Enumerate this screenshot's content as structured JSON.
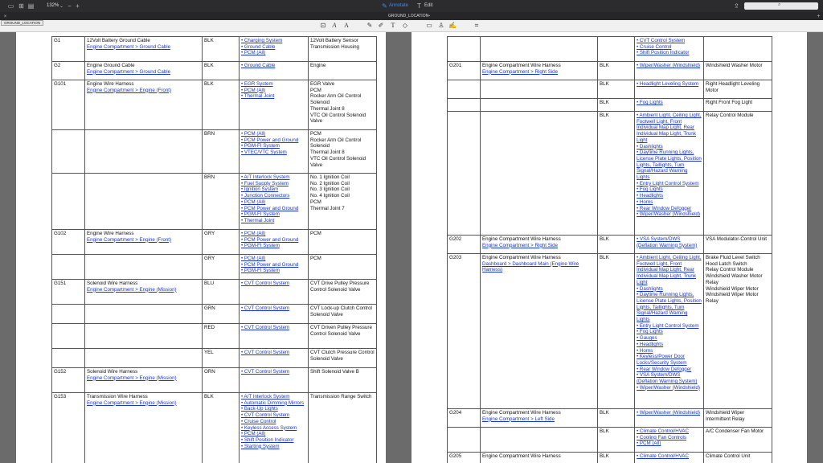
{
  "toolbar": {
    "zoom": "132%"
  },
  "mode_tabs": {
    "annotate": "Annotate",
    "edit": "Edit"
  },
  "document": {
    "title": "GROUND_LOCATION",
    "tab_label": "GROUND_LOCATION"
  },
  "left_rows": [
    {
      "g": "G1",
      "t": "12Volt Battery Ground Cable",
      "p": "Engine Compartment > Ground Cable",
      "c": "BLK",
      "s": [
        "• Charging System",
        "• Ground Cable",
        "• PCM (All)"
      ],
      "x": [
        "12Volt Battery Sensor",
        "Transmission Housing"
      ],
      "h": 31
    },
    {
      "g": "G2",
      "t": "Engine Ground Cable",
      "p": "Engine Compartment > Ground Cable",
      "c": "BLK",
      "s": [
        "• Ground Cable"
      ],
      "x": [
        "Engine"
      ],
      "h": 23
    },
    {
      "g": "G101",
      "t": "Engine Wire Harness",
      "p": "Engine Compartment > Engine (Front)",
      "c": "BLK",
      "s": [
        "• EGR System",
        "• PCM (All)",
        "• Thermal Joint"
      ],
      "x": [
        "EGR Valve",
        "PCM",
        "Rocker Arm Oil Control Solenoid",
        "Thermal Joint 8",
        "VTC Oil Control Solenoid Valve"
      ],
      "h": 62
    },
    {
      "g": "",
      "t": "",
      "p": "",
      "c": "BRN",
      "s": [
        "• PCM (All)",
        "• PCM Power and Ground",
        "• PGM-FI System",
        "• VTEC/VTC System"
      ],
      "x": [
        "PCM",
        "Rocker Arm Oil Control Solenoid",
        "Thermal Joint 8",
        "VTC Oil Control Solenoid Valve"
      ],
      "h": 54
    },
    {
      "g": "",
      "t": "",
      "p": "",
      "c": "BRN",
      "s": [
        "• A/T Interlock System",
        "• Fuel Supply System",
        "• Ignition System",
        "• Junction Connectors",
        "• PCM (All)",
        "• PCM Power and Ground",
        "• PGM-FI System",
        "• Thermal Joint"
      ],
      "x": [
        "No. 1 Ignition Coil",
        "No. 2 Ignition Coil",
        "No. 3 Ignition Coil",
        "No. 4 Ignition Coil",
        "PCM",
        "Thermal Joint 7"
      ],
      "h": 70
    },
    {
      "g": "G102",
      "t": "Engine Wire Harness",
      "p": "Engine Compartment > Engine (Front)",
      "c": "GRY",
      "s": [
        "• PCM (All)",
        "• PCM Power and Ground",
        "• PGM-FI System"
      ],
      "x": [
        "PCM"
      ],
      "h": 31
    },
    {
      "g": "",
      "t": "",
      "p": "",
      "c": "GRY",
      "s": [
        "• PCM (All)",
        "• PCM Power and Ground",
        "• PGM-FI System"
      ],
      "x": [
        "PCM"
      ],
      "h": 31
    },
    {
      "g": "G151",
      "t": "Solenoid Wire Harness",
      "p": "Engine Compartment > Engine (Mission)",
      "c": "BLU",
      "s": [
        "• CVT Control System"
      ],
      "x": [
        "CVT Drive Pulley Pressure Control Solenoid Valve"
      ],
      "h": 31
    },
    {
      "g": "",
      "t": "",
      "p": "",
      "c": "GRN",
      "s": [
        "• CVT Control System"
      ],
      "x": [
        "CVT Lock-up Clutch Control Solenoid Valve"
      ],
      "h": 24
    },
    {
      "g": "",
      "t": "",
      "p": "",
      "c": "RED",
      "s": [
        "• CVT Control System"
      ],
      "x": [
        "CVT Driven Pulley Pressure Control Solenoid Valve"
      ],
      "h": 31
    },
    {
      "g": "",
      "t": "",
      "p": "",
      "c": "YEL",
      "s": [
        "• CVT Control System"
      ],
      "x": [
        "CVT Clutch Pressure Control Solenoid Valve"
      ],
      "h": 24
    },
    {
      "g": "G152",
      "t": "Solenoid Wire Harness",
      "p": "Engine Compartment > Engine (Mission)",
      "c": "ORN",
      "s": [
        "• CVT Control System"
      ],
      "x": [
        "Shift Solenoid Valve B"
      ],
      "h": 31
    },
    {
      "g": "G153",
      "t": "Transmission Wire Harness",
      "p": "Engine Compartment > Engine (Mission)",
      "c": "BLK",
      "s": [
        "• A/T Interlock System",
        "• Automatic Dimming Mirrors",
        "• Back-Up Lights",
        "• CVT Control System",
        "• Cruise Control",
        "• Keyless Access System",
        "• PCM (All)",
        "• Shift Position Indicator",
        "• Starting System"
      ],
      "x": [
        "Transmission Range Switch"
      ],
      "h": 90
    }
  ],
  "right_rows": [
    {
      "g": "",
      "t": "",
      "p": "",
      "c": "",
      "s": [
        "• CVT Control System",
        "• Cruise Control",
        "• Shift Position Indicator"
      ],
      "x": [],
      "h": 31
    },
    {
      "g": "G201",
      "t": "Engine Compartment Wire Harness",
      "p": "Engine Compartment > Right Side",
      "c": "BLK",
      "s": [
        "• Wiper/Washer (Windshield)"
      ],
      "x": [
        "Windshield Washer Motor"
      ],
      "h": 23
    },
    {
      "g": "",
      "t": "",
      "p": "",
      "c": "BLK",
      "s": [
        "• Headlight Leveling System"
      ],
      "x": [
        "Right Headlight Leveling Motor"
      ],
      "h": 23
    },
    {
      "g": "",
      "t": "",
      "p": "",
      "c": "BLK",
      "s": [
        "• Fog Lights"
      ],
      "x": [
        "Right Front Fog Light"
      ],
      "h": 16
    },
    {
      "g": "",
      "t": "",
      "p": "",
      "c": "BLK",
      "s": [
        "• Ambient Light, Ceiling Light, Footwell Light, Front Individual Map Light, Rear Individual Map Light, Trunk Light",
        "• Dashlights",
        "• Daytime Running Lights, License Plate Lights, Position Lights, Taillights, Turn Signal/Hazard Warning Lights",
        "• Entry Light Control System",
        "• Fog Lights",
        "• Headlights",
        "• Horns",
        "• Rear Window Defogger",
        "• Wiper/Washer (Windshield)"
      ],
      "x": [
        "Relay Control Module"
      ],
      "h": 154
    },
    {
      "g": "G202",
      "t": "Engine Compartment Wire Harness",
      "p": "Engine Compartment > Right Side",
      "c": "BLK",
      "s": [
        "• VSA System/DWS (Deflation Warning System)"
      ],
      "x": [
        "VSA Modulator-Control Unit"
      ],
      "h": 23
    },
    {
      "g": "G203",
      "t": "Engine Compartment Wire Harness",
      "p": "Dashboard > Dashboard Main (Engine Wire Harness)",
      "c": "BLK",
      "s": [
        "• Ambient Light, Ceiling Light, Footwell Light, Front Individual Map Light, Rear Individual Map Light, Trunk Light",
        "• Dashlights",
        "• Daytime Running Lights, License Plate Lights, Position Lights, Taillights, Turn Signal/Hazard Warning Lights",
        "• Entry Light Control System",
        "• Fog Lights",
        "• Gauges",
        "• Headlights",
        "• Horns",
        "• Keyless/Power Door Locks/Security System",
        "• Rear Window Defogger",
        "• VSA System/DWS (Deflation Warning System)",
        "• Wiper/Washer (Windshield)"
      ],
      "x": [
        "Brake Fluid Level Switch",
        "Hood Latch Switch",
        "Relay Control Module",
        "Windshield Washer Motor Relay",
        "Windshield Wiper Motor",
        "Windshield Wiper Motor Relay"
      ],
      "h": 193
    },
    {
      "g": "G204",
      "t": "Engine Compartment Wire Harness",
      "p": "Engine Compartment > Left Side",
      "c": "BLK",
      "s": [
        "• Wiper/Washer (Windshield)"
      ],
      "x": [
        "Windshield Wiper Intermittent Relay"
      ],
      "h": 23
    },
    {
      "g": "",
      "t": "",
      "p": "",
      "c": "BLK",
      "s": [
        "• Climate Control/HVAC",
        "• Cooling Fan Controls",
        "• PCM (All)"
      ],
      "x": [
        "A/C Condenser Fan Motor"
      ],
      "h": 31
    },
    {
      "g": "G205",
      "t": "Engine Compartment Wire Harness",
      "p": "",
      "c": "BLK",
      "s": [
        "• Climate Control/HVAC"
      ],
      "x": [
        "Climate Control Unit"
      ],
      "h": 20
    }
  ]
}
